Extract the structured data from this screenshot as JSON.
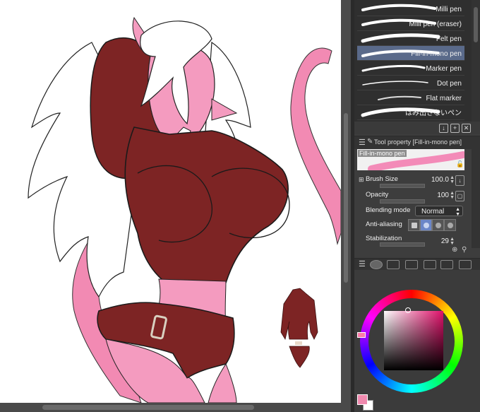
{
  "brushes": [
    {
      "label": "Milli pen",
      "selected": false
    },
    {
      "label": "Milli pen (eraser)",
      "selected": false
    },
    {
      "label": "Felt pen",
      "selected": false
    },
    {
      "label": "Fill-in-mono pen",
      "selected": true
    },
    {
      "label": "Marker pen",
      "selected": false
    },
    {
      "label": "Dot pen",
      "selected": false
    },
    {
      "label": "Flat marker",
      "selected": false
    },
    {
      "label": "はみ出さないペン",
      "selected": false
    }
  ],
  "tool_property": {
    "title": "Tool property [Fill-in-mono pen]",
    "preview_name": "Fill-in-mono pen",
    "brush_size": {
      "label": "Brush Size",
      "value": "100.0"
    },
    "opacity": {
      "label": "Opacity",
      "value": "100"
    },
    "blending_mode": {
      "label": "Blending mode",
      "value": "Normal"
    },
    "anti_aliasing": {
      "label": "Anti-aliasing"
    },
    "stabilization": {
      "label": "Stabilization",
      "value": "29"
    }
  },
  "colors": {
    "main_color": "#f08aaf",
    "sub_color": "#ffffff",
    "accent_selected": "#5a6a8a"
  }
}
